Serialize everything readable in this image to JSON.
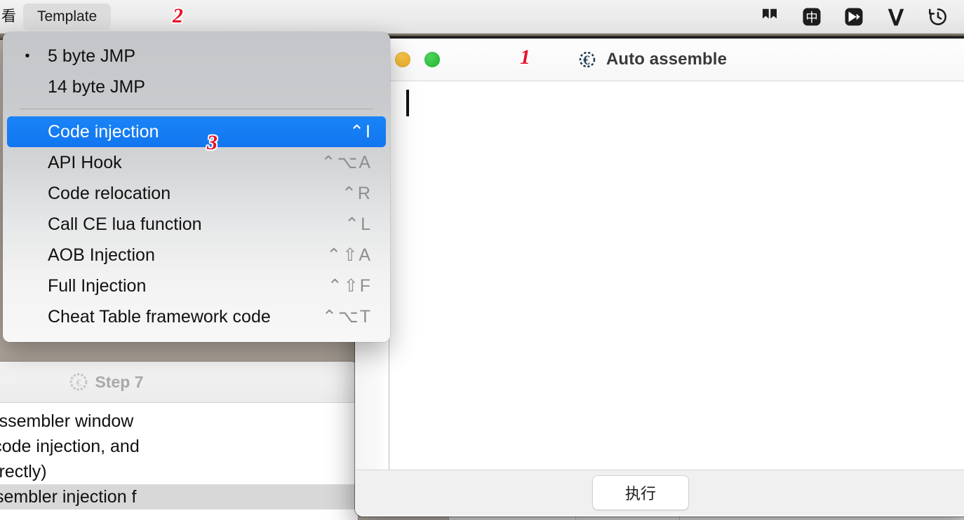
{
  "menubar": {
    "chinese_menu_label": "看",
    "active_menu": "Template",
    "status_icons": [
      {
        "name": "bookmark-split-icon",
        "glyph": "▮▮"
      },
      {
        "name": "chinese-input-icon",
        "glyph": "中"
      },
      {
        "name": "media-play-icon",
        "glyph": "▶"
      },
      {
        "name": "w-logo-icon",
        "glyph": "W"
      },
      {
        "name": "time-machine-icon",
        "glyph": "↻"
      }
    ]
  },
  "annotations": [
    {
      "label": "1",
      "target": "auto-assemble-window-title"
    },
    {
      "label": "2",
      "target": "template-menu"
    },
    {
      "label": "3",
      "target": "code-injection-menu-item"
    }
  ],
  "template_menu": {
    "items": [
      {
        "label": "5 byte JMP",
        "shortcut": "",
        "bullet": "•",
        "selected": false,
        "checked": true
      },
      {
        "label": "14 byte JMP",
        "shortcut": "",
        "bullet": "",
        "selected": false,
        "checked": false
      },
      {
        "separator": true
      },
      {
        "label": "Code injection",
        "shortcut": "⌃I",
        "bullet": "",
        "selected": true,
        "checked": false
      },
      {
        "label": "API Hook",
        "shortcut": "⌃⌥A",
        "bullet": "",
        "selected": false,
        "checked": false
      },
      {
        "label": "Code relocation",
        "shortcut": "⌃R",
        "bullet": "",
        "selected": false,
        "checked": false
      },
      {
        "label": "Call CE lua function",
        "shortcut": "⌃L",
        "bullet": "",
        "selected": false,
        "checked": false
      },
      {
        "label": "AOB Injection",
        "shortcut": "⌃⇧A",
        "bullet": "",
        "selected": false,
        "checked": false
      },
      {
        "label": "Full Injection",
        "shortcut": "⌃⇧F",
        "bullet": "",
        "selected": false,
        "checked": false
      },
      {
        "label": "Cheat Table framework code",
        "shortcut": "⌃⌥T",
        "bullet": "",
        "selected": false,
        "checked": false
      }
    ]
  },
  "auto_assemble_window": {
    "title": "Auto assemble",
    "traffic_lights": {
      "minimize": "yellow",
      "zoom": "green"
    },
    "editor_content": "",
    "execute_button": "执行"
  },
  "step7_window": {
    "title": "Step 7",
    "lines": [
      "d open the auto assembler window",
      "mplate and then code injection, and",
      "lready filled in correctly)",
      "e a basic auto assembler injection f"
    ]
  },
  "colors": {
    "accent_blue": "#1176ef",
    "annotation_red": "#e8142a",
    "traffic_yellow": "#e9a922",
    "traffic_green": "#1eb62f",
    "menu_bg_top": "#c4c6c9",
    "menu_bg_bottom": "#f7f7f7"
  }
}
